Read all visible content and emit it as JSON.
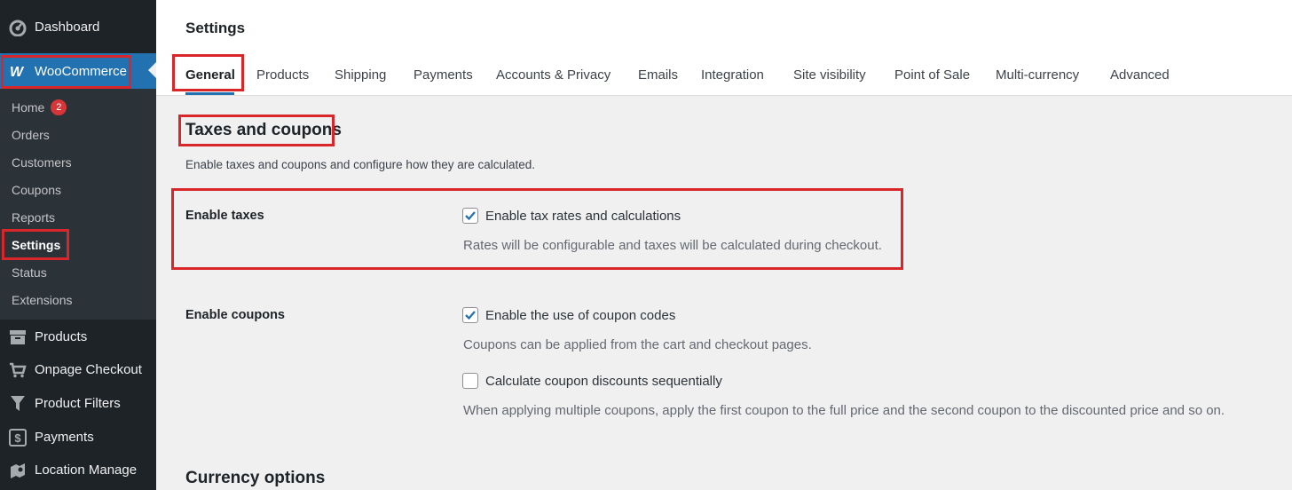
{
  "sidebar": {
    "dashboard": "Dashboard",
    "woocommerce": "WooCommerce",
    "submenu": [
      {
        "label": "Home",
        "badge": "2"
      },
      {
        "label": "Orders"
      },
      {
        "label": "Customers"
      },
      {
        "label": "Coupons"
      },
      {
        "label": "Reports"
      },
      {
        "label": "Settings"
      },
      {
        "label": "Status"
      },
      {
        "label": "Extensions"
      }
    ],
    "menu": [
      "Products",
      "Onpage Checkout",
      "Product Filters",
      "Payments",
      "Location Manage"
    ]
  },
  "header": {
    "title": "Settings",
    "tabs": [
      "General",
      "Products",
      "Shipping",
      "Payments",
      "Accounts & Privacy",
      "Emails",
      "Integration",
      "Site visibility",
      "Point of Sale",
      "Multi-currency",
      "Advanced"
    ]
  },
  "main": {
    "section_title": "Taxes and coupons",
    "section_desc": "Enable taxes and coupons and configure how they are calculated.",
    "enable_taxes": {
      "label": "Enable taxes",
      "checkbox": "Enable tax rates and calculations",
      "checked": true,
      "help": "Rates will be configurable and taxes will be calculated during checkout."
    },
    "enable_coupons": {
      "label": "Enable coupons",
      "checkbox": "Enable the use of coupon codes",
      "checked": true,
      "help": "Coupons can be applied from the cart and checkout pages.",
      "sequential_checkbox": "Calculate coupon discounts sequentially",
      "sequential_checked": false,
      "sequential_help": "When applying multiple coupons, apply the first coupon to the full price and the second coupon to the discounted price and so on."
    },
    "currency_title": "Currency options"
  },
  "colors": {
    "accent": "#2271b1",
    "highlight": "#d9262a",
    "sidebar": "#1d2327"
  }
}
